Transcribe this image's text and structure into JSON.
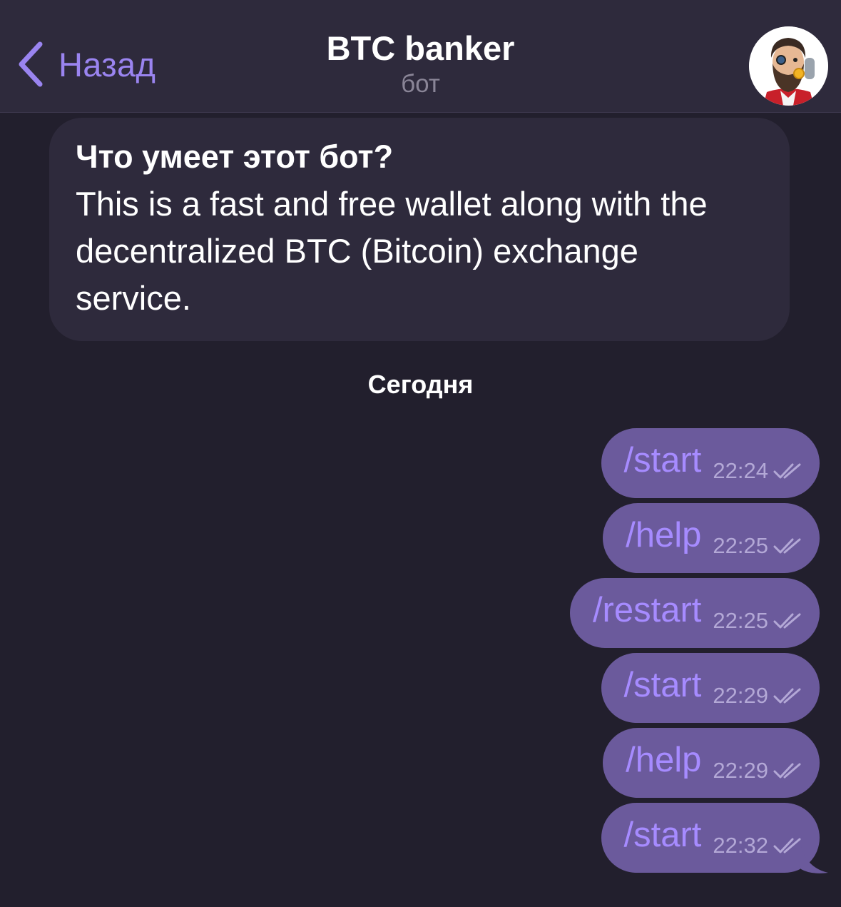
{
  "header": {
    "back_label": "Назад",
    "title": "BTC banker",
    "subtitle": "бот",
    "avatar_icon": "bearded-man-avatar"
  },
  "info": {
    "title": "Что умеет этот бот?",
    "lines": [
      "This is a fast and free wallet along with the",
      "decentralized BTC (Bitcoin) exchange",
      "service."
    ]
  },
  "date_separator": "Сегодня",
  "messages": [
    {
      "text": "/start",
      "time": "22:24",
      "status_icon": "double-check-icon"
    },
    {
      "text": "/help",
      "time": "22:25",
      "status_icon": "double-check-icon"
    },
    {
      "text": "/restart",
      "time": "22:25",
      "status_icon": "double-check-icon"
    },
    {
      "text": "/start",
      "time": "22:29",
      "status_icon": "double-check-icon"
    },
    {
      "text": "/help",
      "time": "22:29",
      "status_icon": "double-check-icon"
    },
    {
      "text": "/start",
      "time": "22:32",
      "status_icon": "double-check-icon"
    }
  ],
  "colors": {
    "background": "#221f2d",
    "header_bg": "#2e2a3c",
    "accent": "#9a84f0",
    "outgoing_bubble": "#6b5a9c",
    "command_text": "#a68bff"
  }
}
